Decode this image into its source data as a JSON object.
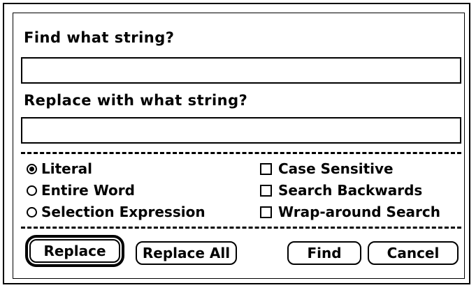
{
  "find": {
    "label": "Find what string?",
    "value": ""
  },
  "replace": {
    "label": "Replace with what string?",
    "value": ""
  },
  "options": {
    "mode": [
      {
        "label": "Literal",
        "checked": true
      },
      {
        "label": "Entire Word",
        "checked": false
      },
      {
        "label": "Selection Expression",
        "checked": false
      }
    ],
    "flags": [
      {
        "label": "Case Sensitive",
        "checked": false
      },
      {
        "label": "Search Backwards",
        "checked": false
      },
      {
        "label": "Wrap-around Search",
        "checked": false
      }
    ]
  },
  "buttons": {
    "replace": "Replace",
    "replace_all": "Replace All",
    "find": "Find",
    "cancel": "Cancel"
  }
}
